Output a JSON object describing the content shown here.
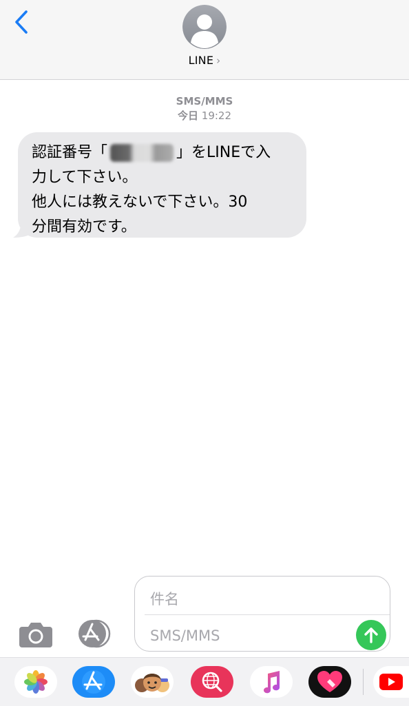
{
  "header": {
    "contact_name": "LINE",
    "contact_chevron": "›",
    "back_icon": "chevron-left-icon",
    "avatar_icon": "person-silhouette-icon"
  },
  "thread": {
    "service_label": "SMS/MMS",
    "day_label": "今日",
    "time_label": "19:22"
  },
  "message": {
    "line1_prefix": "認証番号「",
    "line1_suffix": "」をLINEで入",
    "line2": "力して下さい。",
    "line3": "他人には教えないで下さい。30",
    "line4": "分間有効です。",
    "code_redacted": true
  },
  "composer": {
    "subject_placeholder": "件名",
    "message_placeholder": "SMS/MMS",
    "camera_icon": "camera-icon",
    "apps_icon": "app-store-icon",
    "send_icon": "send-arrow-up-icon",
    "send_color": "#35c759"
  },
  "app_strip": {
    "apps": [
      "photos-icon",
      "app-store-icon",
      "memoji-icon",
      "search-globe-icon",
      "music-icon",
      "heart-app-icon",
      "youtube-icon"
    ]
  },
  "colors": {
    "accent": "#1a7cf5",
    "bubble": "#e9e9eb",
    "meta_text": "#8e8e93"
  }
}
